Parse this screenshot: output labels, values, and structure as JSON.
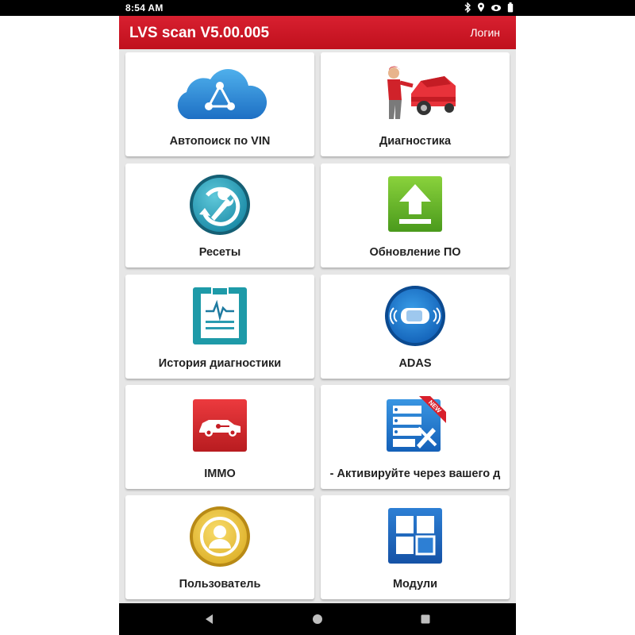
{
  "status_bar": {
    "time": "8:54 AM",
    "icons": [
      "bluetooth-icon",
      "location-icon",
      "eye-icon",
      "battery-icon"
    ]
  },
  "header": {
    "title": "LVS scan V5.00.005",
    "login_label": "Логин",
    "color": "#cc1a26"
  },
  "tiles": [
    {
      "label": "Автопоиск по VIN",
      "icon": "cloud-share-icon"
    },
    {
      "label": "Диагностика",
      "icon": "mechanic-car-icon"
    },
    {
      "label": "Ресеты",
      "icon": "reset-wrench-icon"
    },
    {
      "label": "Обновление ПО",
      "icon": "upload-arrow-icon"
    },
    {
      "label": "История диагностики",
      "icon": "clipboard-history-icon"
    },
    {
      "label": "ADAS",
      "icon": "adas-car-icon"
    },
    {
      "label": "IMMO",
      "icon": "car-key-icon"
    },
    {
      "label": "- Активируйте через вашего д",
      "icon": "server-tools-icon",
      "badge": "NEW"
    },
    {
      "label": "Пользователь",
      "icon": "user-icon"
    },
    {
      "label": "Модули",
      "icon": "modules-grid-icon"
    }
  ],
  "nav_bar": {
    "icons": [
      "back-icon",
      "home-icon",
      "recents-icon"
    ]
  }
}
